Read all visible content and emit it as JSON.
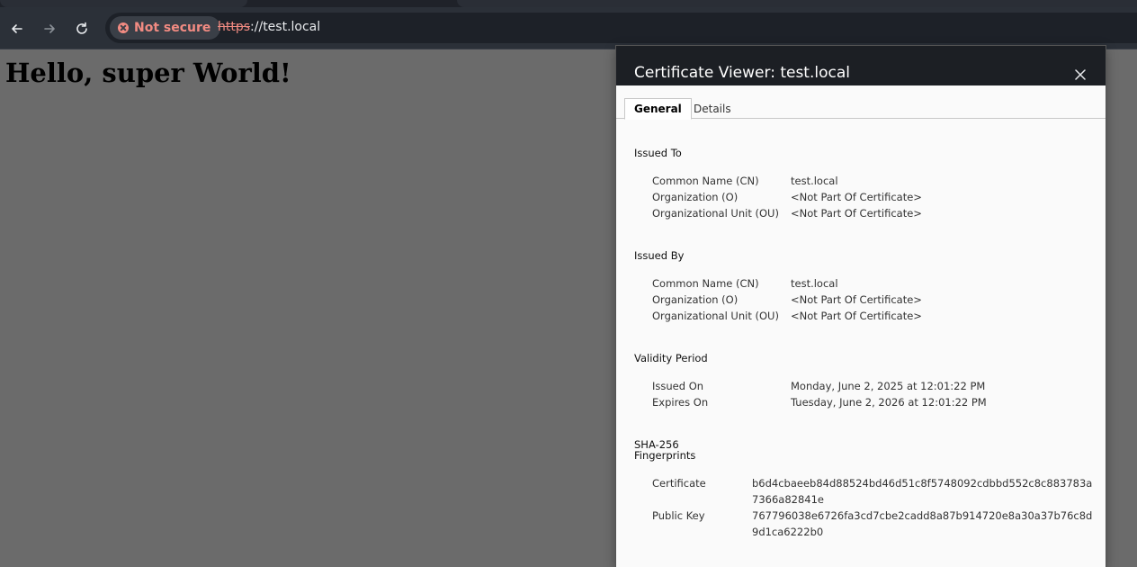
{
  "browser": {
    "security_label": "Not secure",
    "url_scheme": "https",
    "url_rest": "://test.local"
  },
  "page": {
    "heading": "Hello, super World!"
  },
  "dialog": {
    "title": "Certificate Viewer: test.local",
    "tabs": [
      {
        "label": "General",
        "active": true
      },
      {
        "label": "Details",
        "active": false
      }
    ],
    "issued_to": {
      "title": "Issued To",
      "rows": [
        {
          "label": "Common Name (CN)",
          "value": "test.local"
        },
        {
          "label": "Organization (O)",
          "value": "<Not Part Of Certificate>"
        },
        {
          "label": "Organizational Unit (OU)",
          "value": "<Not Part Of Certificate>"
        }
      ]
    },
    "issued_by": {
      "title": "Issued By",
      "rows": [
        {
          "label": "Common Name (CN)",
          "value": "test.local"
        },
        {
          "label": "Organization (O)",
          "value": "<Not Part Of Certificate>"
        },
        {
          "label": "Organizational Unit (OU)",
          "value": "<Not Part Of Certificate>"
        }
      ]
    },
    "validity": {
      "title": "Validity Period",
      "rows": [
        {
          "label": "Issued On",
          "value": "Monday, June 2, 2025 at 12:01:22 PM"
        },
        {
          "label": "Expires On",
          "value": "Tuesday, June 2, 2026 at 12:01:22 PM"
        }
      ]
    },
    "fingerprints": {
      "title_line1": "SHA-256",
      "title_line2": "Fingerprints",
      "rows": [
        {
          "label": "Certificate",
          "value": "b6d4cbaeeb84d88524bd46d51c8f5748092cdbbd552c8c883783a7366a82841e"
        },
        {
          "label": "Public Key",
          "value": "767796038e6726fa3cd7cbe2cadd8a87b914720e8a30a37b76c8d9d1ca6222b0"
        }
      ]
    }
  },
  "colors": {
    "page_background": "#6b6b6b",
    "toolbar": "#2b3038",
    "security_warning": "#f28b82",
    "dialog_header": "#1c1f24",
    "dialog_body": "#fafafa"
  }
}
